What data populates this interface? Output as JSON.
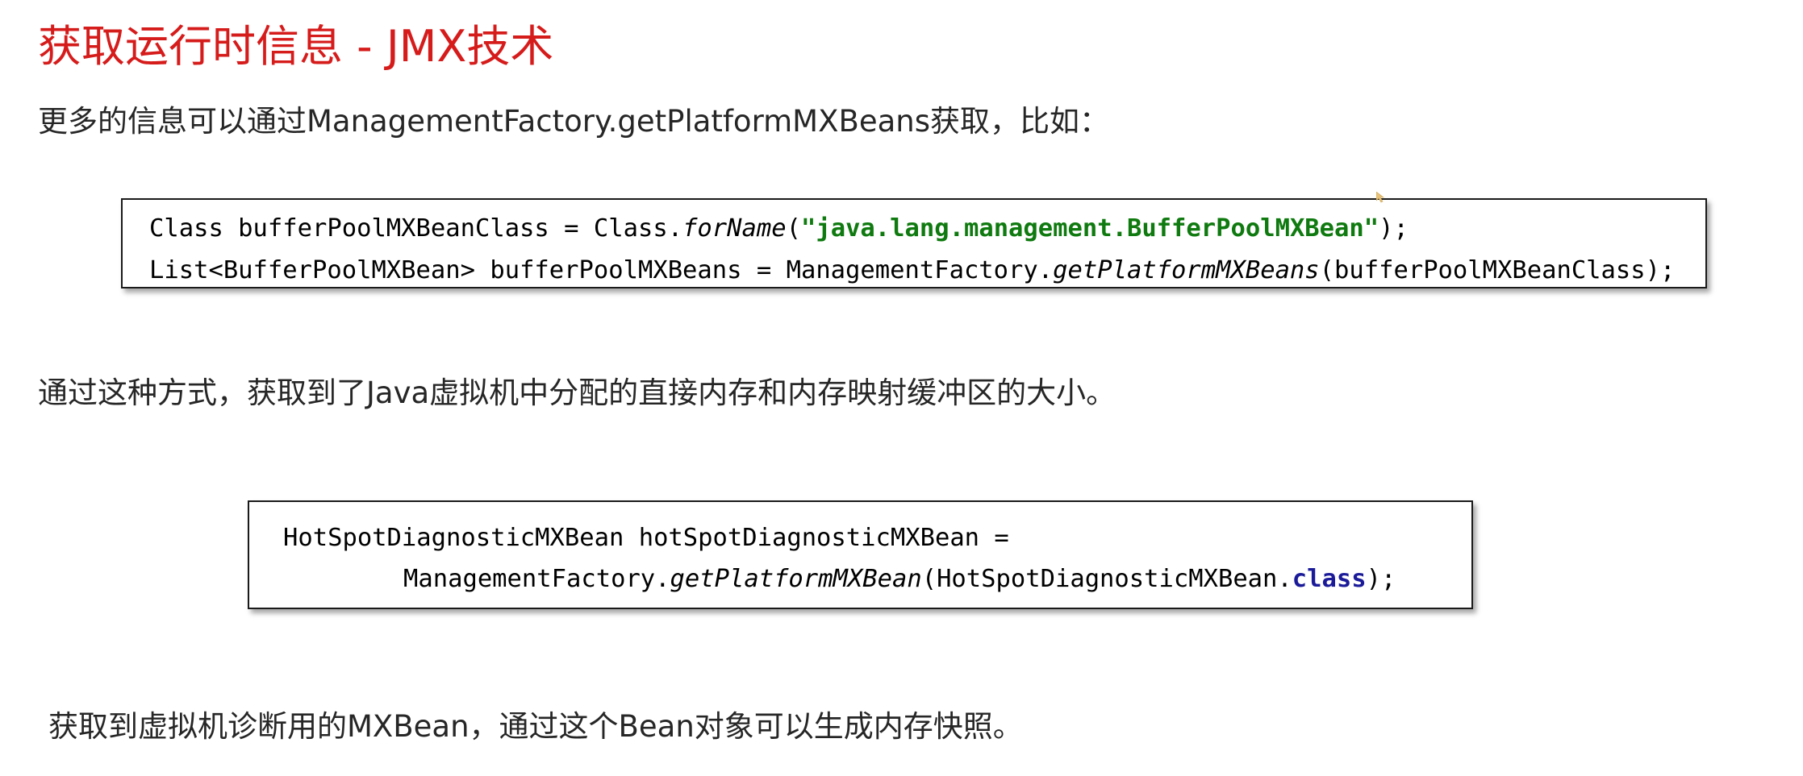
{
  "title": "获取运行时信息 - JMX技术",
  "para1": "更多的信息可以通过ManagementFactory.getPlatformMXBeans获取，比如：",
  "code1": {
    "line1": {
      "a": "Class bufferPoolMXBeanClass = Class.",
      "b": "forName",
      "c": "(",
      "d": "\"java.lang.management.BufferPoolMXBean\"",
      "e": ");"
    },
    "line2": {
      "a": "List<BufferPoolMXBean> bufferPoolMXBeans = ManagementFactory.",
      "b": "getPlatformMXBeans",
      "c": "(bufferPoolMXBeanClass);"
    }
  },
  "para2": "通过这种方式，获取到了Java虚拟机中分配的直接内存和内存映射缓冲区的大小。",
  "code2": {
    "line1": {
      "a": "HotSpotDiagnosticMXBean hotSpotDiagnosticMXBean ="
    },
    "line2": {
      "a": "ManagementFactory.",
      "b": "getPlatformMXBean",
      "c": "(HotSpotDiagnosticMXBean.",
      "d": "class",
      "e": ");"
    }
  },
  "para3": "获取到虚拟机诊断用的MXBean，通过这个Bean对象可以生成内存快照。",
  "colors": {
    "title": "#d61b1b",
    "string_literal": "#0f7a0f",
    "keyword": "#1b1b9a"
  }
}
